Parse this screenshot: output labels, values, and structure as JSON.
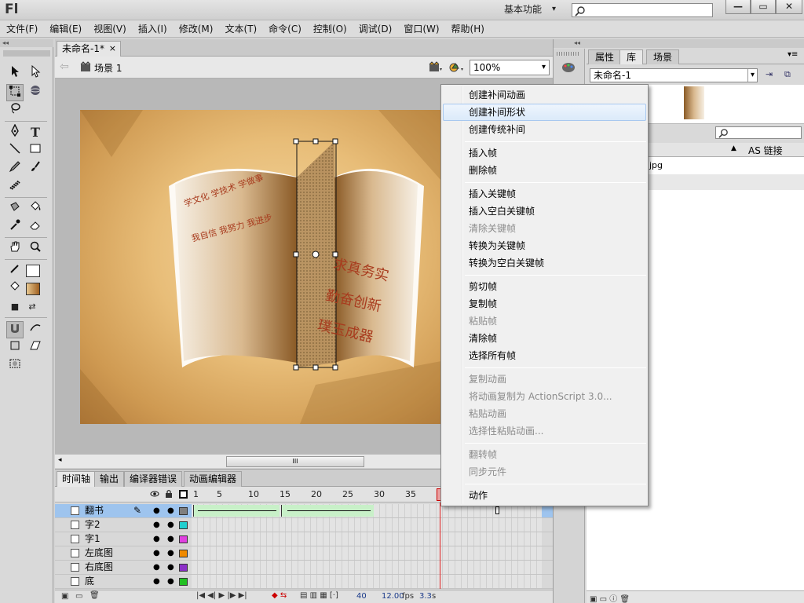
{
  "app": {
    "logo": "Fl",
    "workspace": "基本功能",
    "window_buttons": [
      "—",
      "▭",
      "✕"
    ]
  },
  "menubar": [
    "文件(F)",
    "编辑(E)",
    "视图(V)",
    "插入(I)",
    "修改(M)",
    "文本(T)",
    "命令(C)",
    "控制(O)",
    "调试(D)",
    "窗口(W)",
    "帮助(H)"
  ],
  "document": {
    "tab_label": "未命名-1*",
    "close_glyph": "×",
    "scene_label": "场景 1",
    "zoom": "100%"
  },
  "stage": {
    "left_page_lines": [
      "学文化  学技术  学做事",
      "我自信  我努力  我进步"
    ],
    "right_page_lines": [
      "求真务实",
      "勤奋创新",
      "璞玉成器"
    ]
  },
  "hscroll_thumb": "III",
  "timeline": {
    "tabs": [
      "时间轴",
      "输出",
      "编译器错误",
      "动画编辑器"
    ],
    "frame_numbers": [
      "1",
      "5",
      "10",
      "15",
      "20",
      "25",
      "30",
      "35"
    ],
    "layers": [
      {
        "name": "翻书",
        "color": "#7f7f7f",
        "selected": true
      },
      {
        "name": "字2",
        "color": "#22d0d0",
        "selected": false
      },
      {
        "name": "字1",
        "color": "#e040e0",
        "selected": false
      },
      {
        "name": "左底图",
        "color": "#f08a00",
        "selected": false
      },
      {
        "name": "右底图",
        "color": "#8c2fc8",
        "selected": false
      },
      {
        "name": "底",
        "color": "#22c022",
        "selected": false
      }
    ],
    "footer": {
      "current_frame": "40",
      "fps": "12.00",
      "fps_unit": "fps",
      "time": "3.3",
      "time_unit": "s"
    }
  },
  "right_panel": {
    "tabs": [
      "属性",
      "库",
      "场景"
    ],
    "library_select": "未命名-1",
    "col_header": "AS 链接",
    "library_item": "jpg"
  },
  "context_menu": {
    "groups": [
      [
        {
          "label": "创建补间动画",
          "enabled": true,
          "highlighted": false
        },
        {
          "label": "创建补间形状",
          "enabled": true,
          "highlighted": true
        },
        {
          "label": "创建传统补间",
          "enabled": true,
          "highlighted": false
        }
      ],
      [
        {
          "label": "插入帧",
          "enabled": true
        },
        {
          "label": "删除帧",
          "enabled": true
        }
      ],
      [
        {
          "label": "插入关键帧",
          "enabled": true
        },
        {
          "label": "插入空白关键帧",
          "enabled": true
        },
        {
          "label": "清除关键帧",
          "enabled": false
        },
        {
          "label": "转换为关键帧",
          "enabled": true
        },
        {
          "label": "转换为空白关键帧",
          "enabled": true
        }
      ],
      [
        {
          "label": "剪切帧",
          "enabled": true
        },
        {
          "label": "复制帧",
          "enabled": true
        },
        {
          "label": "粘贴帧",
          "enabled": false
        },
        {
          "label": "清除帧",
          "enabled": true
        },
        {
          "label": "选择所有帧",
          "enabled": true
        }
      ],
      [
        {
          "label": "复制动画",
          "enabled": false
        },
        {
          "label": "将动画复制为 ActionScript 3.0...",
          "enabled": false
        },
        {
          "label": "粘贴动画",
          "enabled": false
        },
        {
          "label": "选择性粘贴动画...",
          "enabled": false
        }
      ],
      [
        {
          "label": "翻转帧",
          "enabled": false
        },
        {
          "label": "同步元件",
          "enabled": false
        }
      ],
      [
        {
          "label": "动作",
          "enabled": true
        }
      ]
    ]
  }
}
